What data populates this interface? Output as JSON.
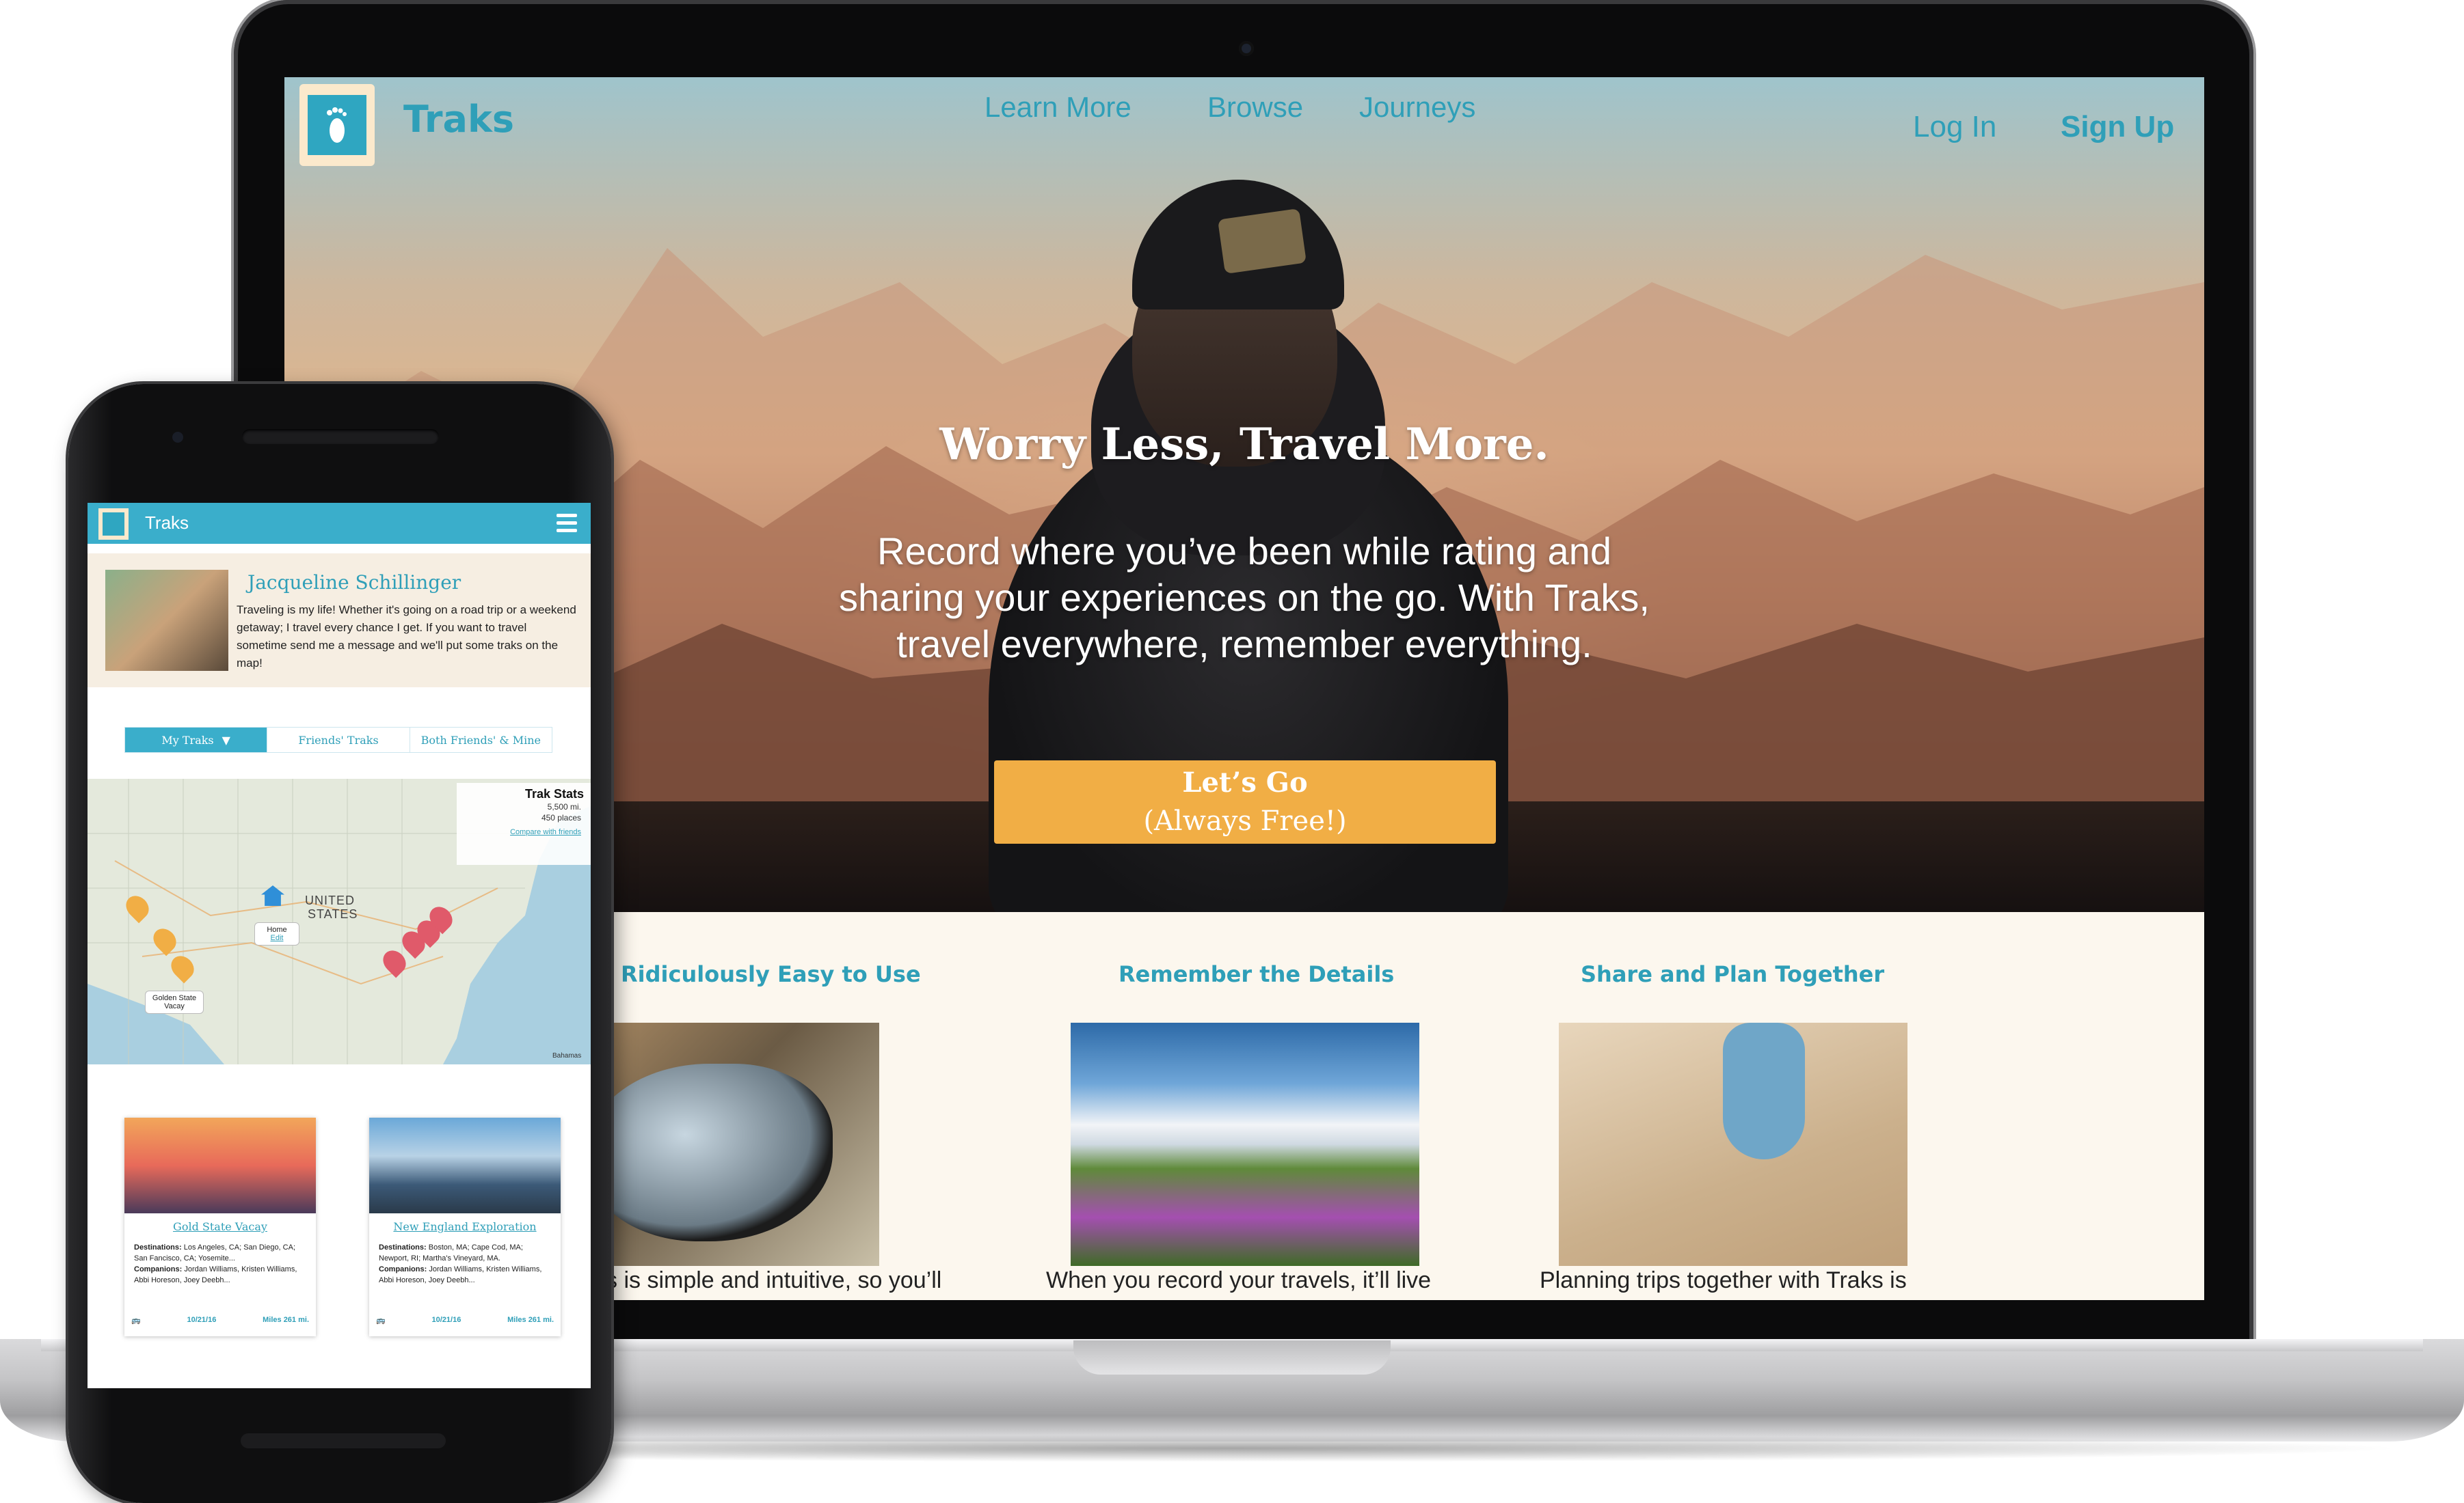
{
  "laptop_site": {
    "brand": "Traks",
    "nav": [
      "Learn More",
      "Browse",
      "Journeys"
    ],
    "auth": {
      "login": "Log In",
      "signup": "Sign Up"
    },
    "hero": {
      "title": "Worry Less, Travel More.",
      "body": "Record where you’ve been while rating and sharing your experiences on the go. With Traks, travel everywhere, remember everything.",
      "cta_line1": "Let’s Go",
      "cta_line2": "(Always Free!)"
    },
    "features": [
      {
        "title": "Ridiculously Easy to Use",
        "snippet": "s is simple and intuitive, so you’ll"
      },
      {
        "title": "Remember the Details",
        "snippet": "When you record your travels, it’ll live"
      },
      {
        "title": "Share and Plan Together",
        "snippet": "Planning trips together with Traks is"
      }
    ]
  },
  "phone_app": {
    "brand": "Traks",
    "profile": {
      "name": "Jacqueline Schillinger",
      "bio": "Traveling is my life! Whether it's going on a road trip or a weekend getaway; I travel every chance I get. If you want to travel sometime send me a message and we'll put some traks on the map!"
    },
    "tabs": [
      "My Traks",
      "Friends' Traks",
      "Both Friends' & Mine"
    ],
    "active_tab_caret": "▼",
    "map": {
      "stats_title": "Trak Stats",
      "stats_miles": "5,500 mi.",
      "stats_places": "450 places",
      "compare_link": "Compare with friends",
      "country_label_1": "UNITED",
      "country_label_2": "STATES",
      "home_label": "Home",
      "home_link": "Edit",
      "trip_label": "Golden State Vacay",
      "bahamas": "Bahamas",
      "pins_yellow": [
        "1",
        "1",
        "1"
      ],
      "pins_red": [
        "4",
        "4",
        "4",
        "4"
      ]
    },
    "cards": [
      {
        "title": "Gold State Vacay",
        "destinations_label": "Destinations:",
        "destinations": "Los Angeles, CA; San Diego, CA; San Fancisco, CA; Yosemite...",
        "companions_label": "Companions:",
        "companions": "Jordan Williams, Kristen Williams, Abbi Horeson, Joey Deebh...",
        "date": "10/21/16",
        "miles": "Miles 261 mi."
      },
      {
        "title": "New England Exploration",
        "destinations_label": "Destinations:",
        "destinations": "Boston, MA; Cape Cod, MA; Newport, RI; Martha's Vineyard, MA.",
        "companions_label": "Companions:",
        "companions": "Jordan Williams, Kristen Williams, Abbi Horeson, Joey Deebh...",
        "date": "10/21/16",
        "miles": "Miles 261 mi."
      }
    ]
  },
  "colors": {
    "brand_teal": "#2f9fb8",
    "cta_orange": "#f1ae45",
    "cream": "#fcf7ee"
  },
  "icons": [
    "footprint-icon",
    "hamburger-menu-icon",
    "home-pin-icon",
    "map-pin-icon",
    "bus-icon",
    "walk-icon"
  ]
}
